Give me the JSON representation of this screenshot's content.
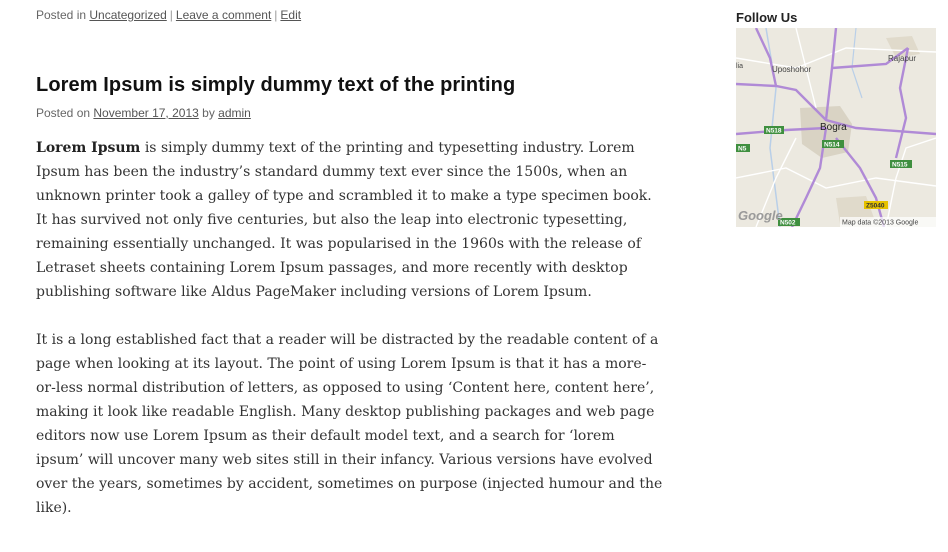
{
  "previous_post": {
    "posted_in": "Posted in",
    "category": "Uncategorized",
    "sep1": "|",
    "leave_comment": "Leave a comment",
    "sep2": "|",
    "edit": "Edit"
  },
  "post": {
    "title": "Lorem Ipsum is simply dummy text of the printing",
    "posted_on": "Posted on",
    "date": "November 17, 2013",
    "by": "by",
    "author": "admin",
    "p1_lead": "Lorem Ipsum",
    "p1_rest": " is simply dummy text of the printing and typesetting industry. Lorem Ipsum has been the industry’s standard dummy text ever since the 1500s, when an unknown printer took a galley of type and scrambled it to make a type specimen book. It has survived not only five centuries, but also the leap into electronic typesetting, remaining essentially unchanged. It was popularised in the 1960s with the release of Letraset sheets containing Lorem Ipsum passages, and more recently with desktop publishing software like Aldus PageMaker including versions of Lorem Ipsum.",
    "p2": "It is a long established fact that a reader will be distracted by the readable content of a page when looking at its layout. The point of using Lorem Ipsum is that it has a more-or-less normal distribution of letters, as opposed to using ‘Content here, content here’, making it look like readable English. Many desktop publishing packages and web page editors now use Lorem Ipsum as their default model text, and a search for ‘lorem ipsum’ will uncover many web sites still in their infancy. Various versions have evolved over the years, sometimes by accident, sometimes on purpose (injected humour and the like)."
  },
  "sidebar": {
    "widget_title": "Follow Us",
    "map": {
      "city": "Bogra",
      "labels": [
        "Uposhohor",
        "Rajapur",
        "N518",
        "N5",
        "N514",
        "N515",
        "Z5040",
        "N502",
        "lia"
      ],
      "logo": "Google",
      "attribution": "Map data ©2013 Google",
      "colors": {
        "land": "#ece9e0",
        "urban": "#d9d3c4",
        "road": "#b08ad6",
        "highway_badge": "#3f8f3f",
        "regional_badge": "#e6c200"
      }
    }
  }
}
